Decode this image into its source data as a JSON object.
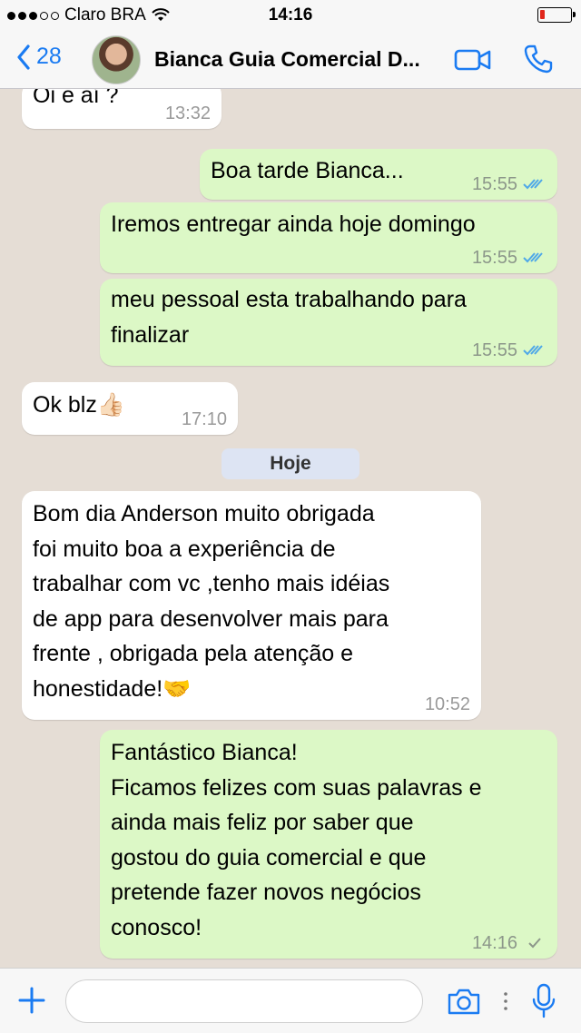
{
  "status_bar": {
    "carrier": "Claro BRA",
    "time": "14:16",
    "battery_level": 0.15
  },
  "nav": {
    "back_count": "28",
    "title": "Bianca Guia Comercial D..."
  },
  "messages": [
    {
      "direction": "in",
      "lines": [
        "Oi e aí ?"
      ],
      "time": "13:32"
    },
    {
      "direction": "out",
      "lines": [
        "Boa tarde Bianca..."
      ],
      "time": "15:55",
      "status": "read"
    },
    {
      "direction": "out",
      "lines": [
        "Iremos entregar ainda hoje domingo"
      ],
      "time": "15:55",
      "status": "read"
    },
    {
      "direction": "out",
      "lines": [
        "meu pessoal esta trabalhando para",
        "finalizar"
      ],
      "time": "15:55",
      "status": "read"
    },
    {
      "direction": "in",
      "lines": [
        "Ok blz👍🏻"
      ],
      "time": "17:10"
    },
    {
      "direction": "in",
      "lines": [
        "Bom dia Anderson muito obrigada",
        "foi muito boa a experiência de",
        "trabalhar com vc ,tenho mais idéias",
        "de app para desenvolver mais para",
        "frente , obrigada pela atenção e",
        "honestidade!🤝"
      ],
      "time": "10:52"
    },
    {
      "direction": "out",
      "lines": [
        "Fantástico Bianca!",
        "Ficamos felizes com suas palavras e",
        "ainda mais feliz por saber que",
        "gostou do guia comercial e que",
        "pretende fazer novos negócios",
        "conosco!"
      ],
      "time": "14:16",
      "status": "sent"
    }
  ],
  "day_separator": "Hoje",
  "input": {
    "placeholder": ""
  },
  "colors": {
    "accent": "#1a7bf2",
    "outgoing_bubble": "#dcf8c6",
    "incoming_bubble": "#ffffff",
    "chat_background": "#e5ddd5",
    "read_check": "#4fa8e8",
    "battery_low": "#e0261b"
  },
  "icons": {
    "back": "chevron-left-icon",
    "video": "video-camera-icon",
    "call": "phone-icon",
    "plus": "plus-icon",
    "camera": "camera-icon",
    "mic": "microphone-icon",
    "wifi": "wifi-icon"
  }
}
